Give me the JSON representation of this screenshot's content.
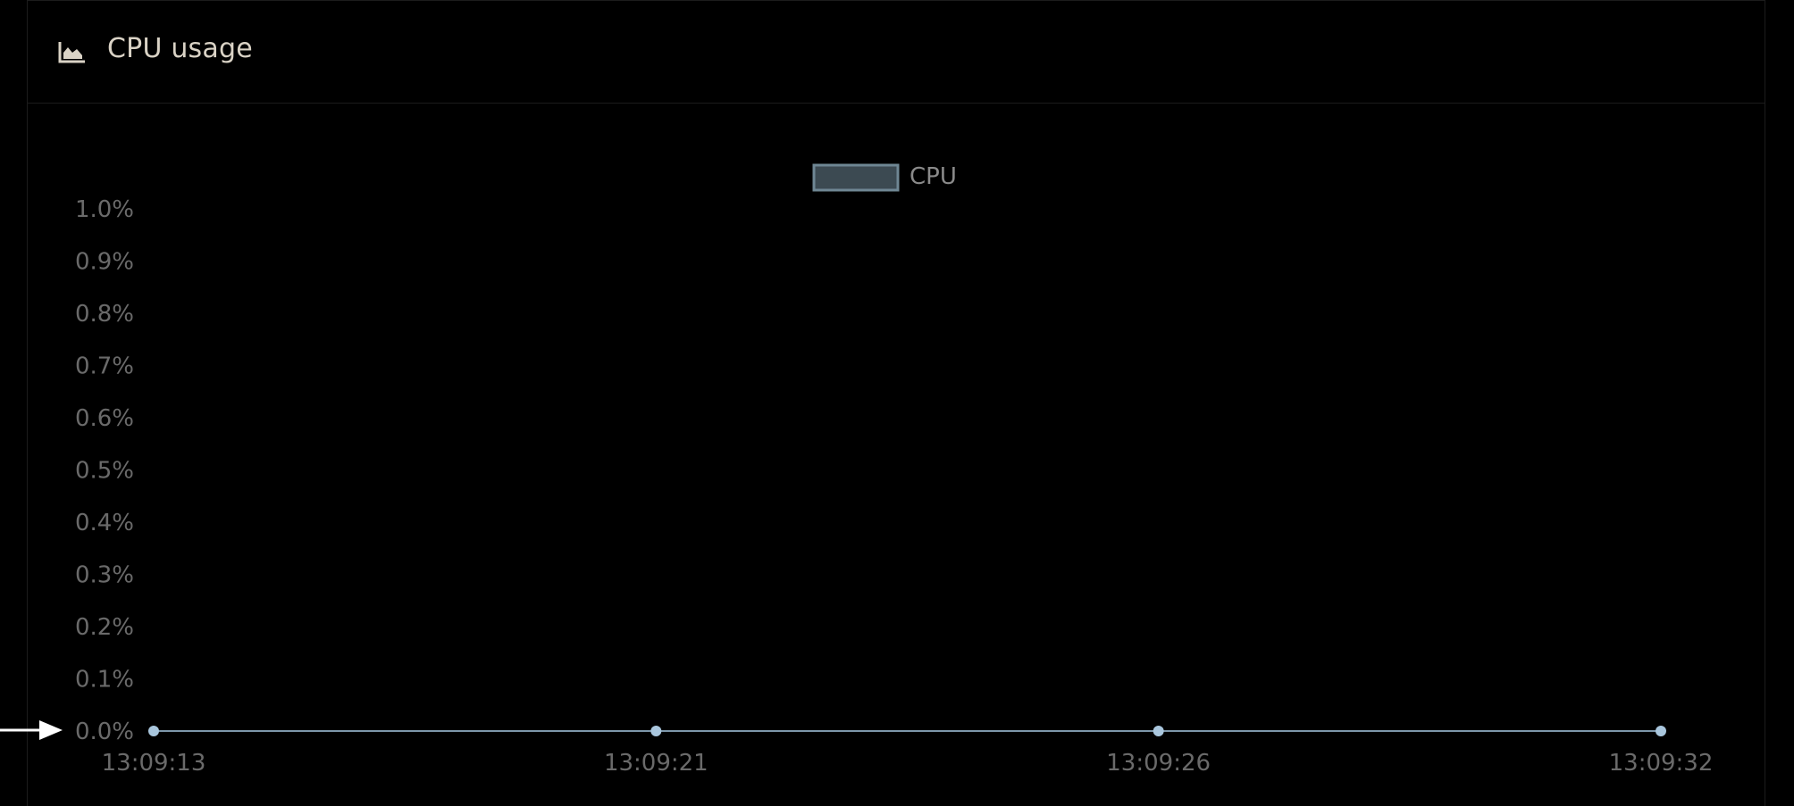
{
  "panel": {
    "title": "CPU usage",
    "icon": "area-chart-icon"
  },
  "colors": {
    "background": "#000000",
    "line": "#7d97aa",
    "point": "#a9c6dd",
    "legend_fill": "#3c4a52",
    "legend_border": "#6f8794",
    "title_text": "#d9d2c5",
    "tick_text": "#6a6a6a"
  },
  "chart_data": {
    "type": "line",
    "legend": [
      "CPU"
    ],
    "legend_position": "top-center",
    "x": [
      "13:09:13",
      "13:09:21",
      "13:09:26",
      "13:09:32"
    ],
    "series": [
      {
        "name": "CPU",
        "values": [
          0.0,
          0.0,
          0.0,
          0.0
        ]
      }
    ],
    "y_ticks": [
      "0.0%",
      "0.1%",
      "0.2%",
      "0.3%",
      "0.4%",
      "0.5%",
      "0.6%",
      "0.7%",
      "0.8%",
      "0.9%",
      "1.0%"
    ],
    "ylim": [
      0.0,
      1.0
    ],
    "grid": false
  },
  "annotation": {
    "icon": "arrow-right-icon"
  }
}
